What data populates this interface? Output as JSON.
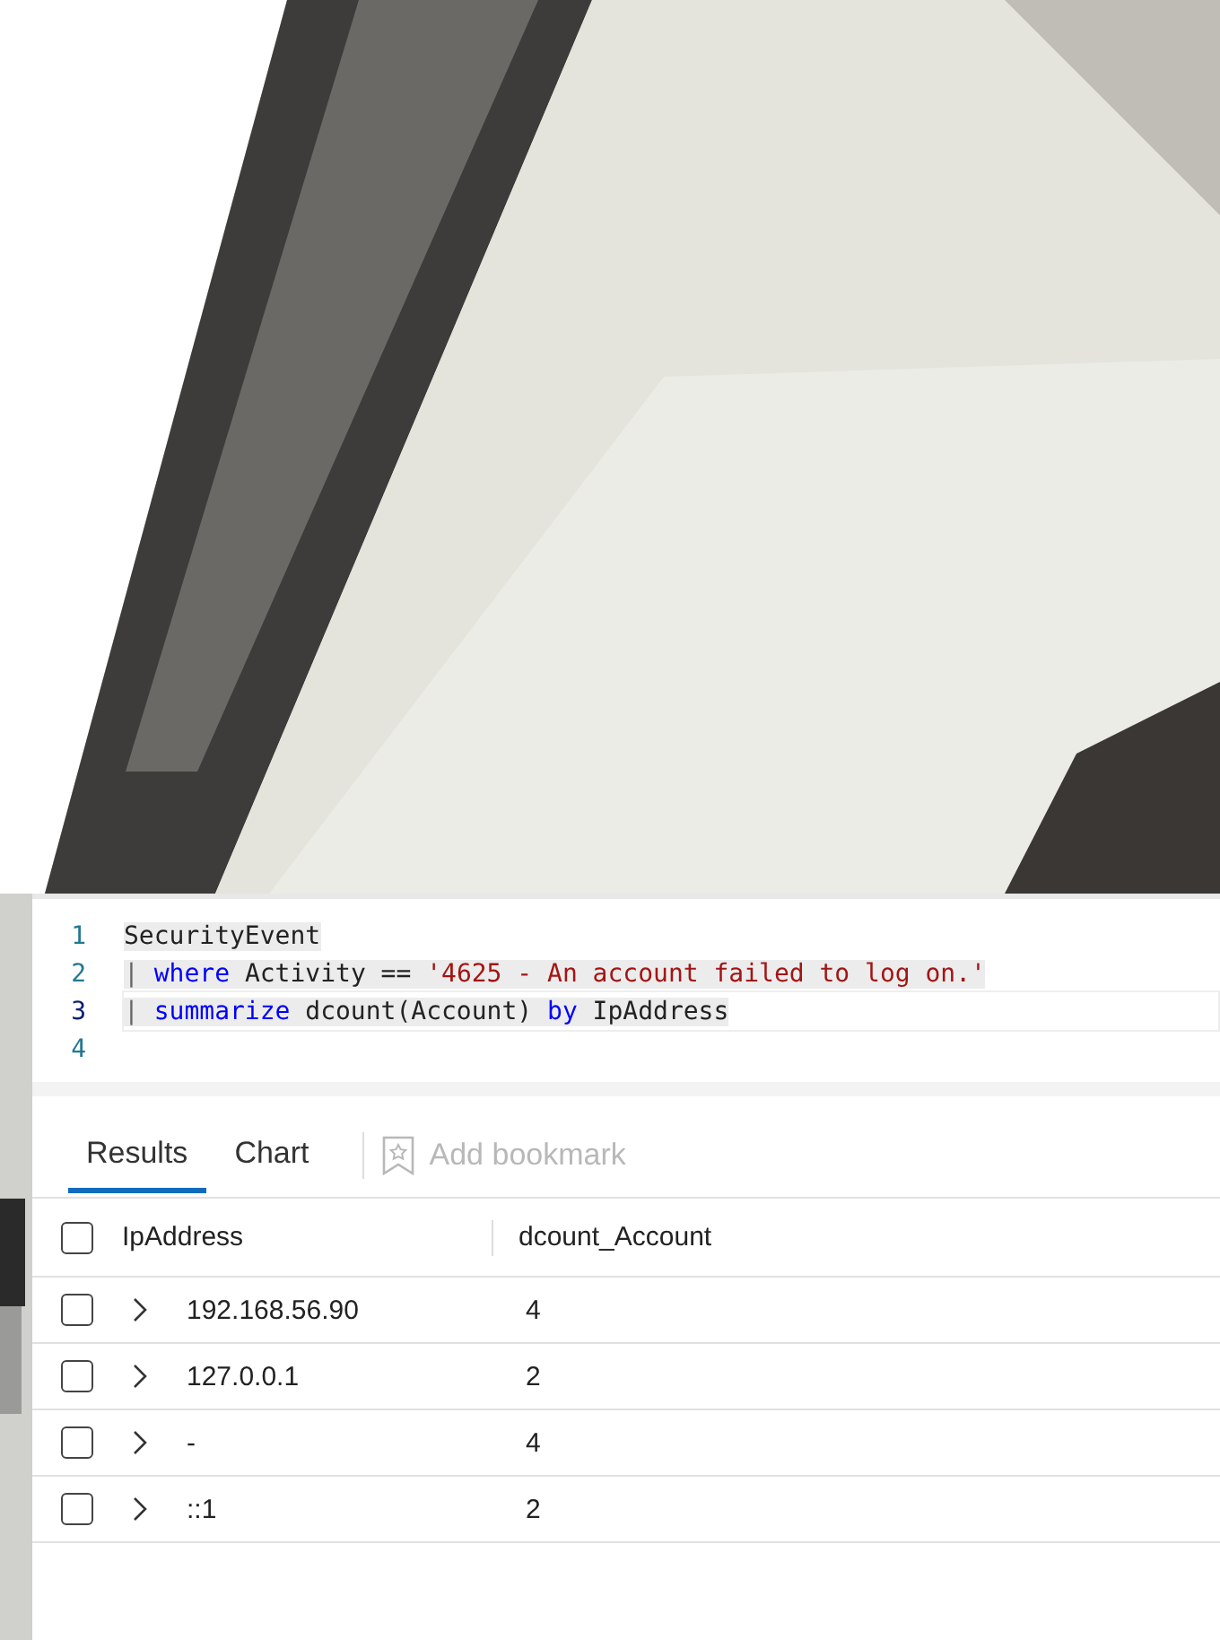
{
  "editor": {
    "lines": [
      {
        "number": "1",
        "current": false,
        "tokens": [
          {
            "text": "SecurityEvent",
            "kind": "plain"
          }
        ]
      },
      {
        "number": "2",
        "current": false,
        "tokens": [
          {
            "text": "| ",
            "kind": "pipe"
          },
          {
            "text": "where",
            "kind": "keyword"
          },
          {
            "text": " Activity == ",
            "kind": "plain"
          },
          {
            "text": "'4625 - An account failed to log on.'",
            "kind": "string"
          }
        ]
      },
      {
        "number": "3",
        "current": true,
        "tokens": [
          {
            "text": "| ",
            "kind": "pipe"
          },
          {
            "text": "summarize",
            "kind": "keyword"
          },
          {
            "text": " dcount(Account) ",
            "kind": "plain"
          },
          {
            "text": "by",
            "kind": "keyword"
          },
          {
            "text": " IpAddress",
            "kind": "plain"
          }
        ]
      },
      {
        "number": "4",
        "current": false
      }
    ]
  },
  "tabs": [
    {
      "label": "Results",
      "selected": true
    },
    {
      "label": "Chart",
      "selected": false
    }
  ],
  "bookmark": {
    "label": "Add bookmark",
    "disabled": true
  },
  "table": {
    "select_all": {
      "checked": false
    },
    "columns": [
      "IpAddress",
      "dcount_Account"
    ],
    "rows": [
      {
        "checked": false,
        "expanded": false,
        "cells": [
          "192.168.56.90",
          "4"
        ]
      },
      {
        "checked": false,
        "expanded": false,
        "cells": [
          "127.0.0.1",
          "2"
        ]
      },
      {
        "checked": false,
        "expanded": false,
        "cells": [
          "-",
          "4"
        ]
      },
      {
        "checked": false,
        "expanded": false,
        "cells": [
          "::1",
          "2"
        ]
      }
    ]
  }
}
